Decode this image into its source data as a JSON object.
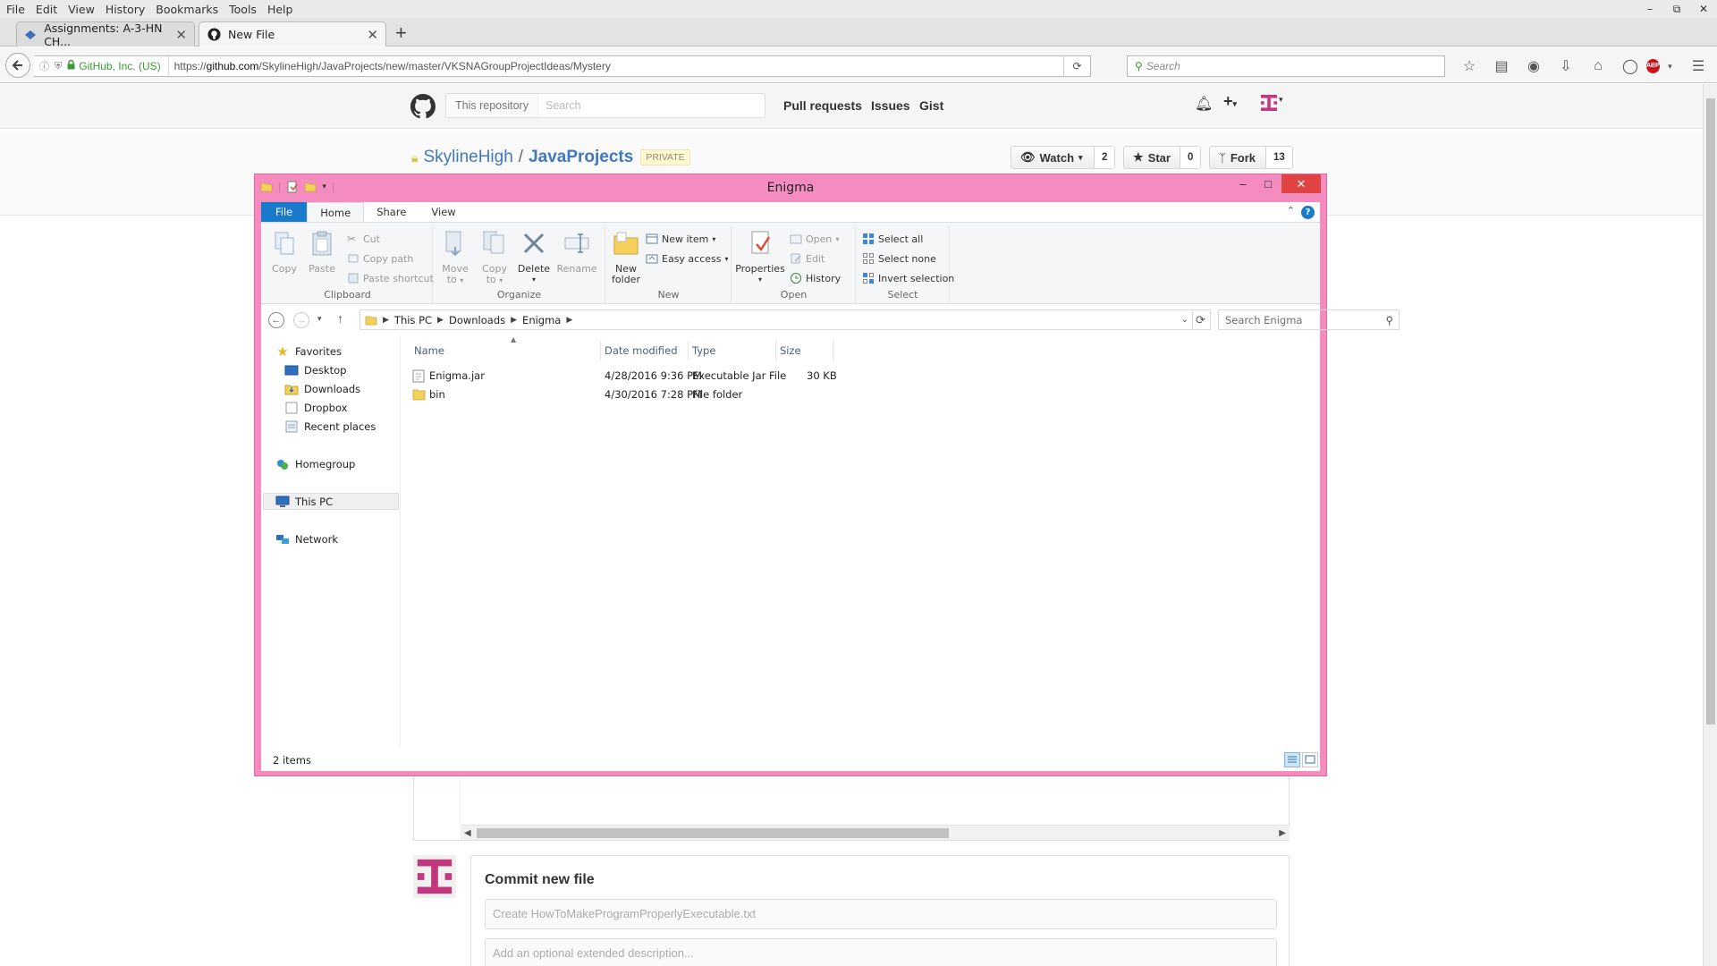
{
  "browser": {
    "menu": [
      "File",
      "Edit",
      "View",
      "History",
      "Bookmarks",
      "Tools",
      "Help"
    ],
    "tabs": [
      {
        "label": "Assignments: A-3-HN CH..."
      },
      {
        "label": "New File"
      }
    ],
    "identity": "GitHub, Inc. (US)",
    "url_prefix": "https://",
    "url_domain": "github.com",
    "url_path": "/SkylineHigh/JavaProjects/new/master/VKSNAGroupProjectIdeas/Mystery",
    "search_placeholder": "Search"
  },
  "github": {
    "search_scope": "This repository",
    "search_placeholder": "Search",
    "nav": [
      "Pull requests",
      "Issues",
      "Gist"
    ],
    "owner": "SkylineHigh",
    "repo": "JavaProjects",
    "private_label": "PRIVATE",
    "watch": {
      "label": "Watch",
      "count": "2"
    },
    "star": {
      "label": "Star",
      "count": "0"
    },
    "fork": {
      "label": "Fork",
      "count": "13"
    },
    "commit_title": "Commit new file",
    "commit_placeholder": "Create HowToMakeProgramProperlyExecutable.txt",
    "description_placeholder": "Add an optional extended description..."
  },
  "explorer": {
    "title": "Enigma",
    "ribbon_tabs": [
      "File",
      "Home",
      "Share",
      "View"
    ],
    "groups": {
      "clipboard": {
        "label": "Clipboard",
        "copy": "Copy",
        "paste": "Paste",
        "cut": "Cut",
        "copy_path": "Copy path",
        "paste_shortcut": "Paste shortcut"
      },
      "organize": {
        "label": "Organize",
        "move_to_1": "Move",
        "move_to_2": "to",
        "copy_to_1": "Copy",
        "copy_to_2": "to",
        "delete": "Delete",
        "rename": "Rename"
      },
      "new": {
        "label": "New",
        "new_folder_1": "New",
        "new_folder_2": "folder",
        "new_item": "New item",
        "easy_access": "Easy access"
      },
      "open": {
        "label": "Open",
        "properties": "Properties",
        "open": "Open",
        "edit": "Edit",
        "history": "History"
      },
      "select": {
        "label": "Select",
        "select_all": "Select all",
        "select_none": "Select none",
        "invert": "Invert selection"
      }
    },
    "breadcrumb": [
      "This PC",
      "Downloads",
      "Enigma"
    ],
    "search_placeholder": "Search Enigma",
    "nav": {
      "favorites": "Favorites",
      "desktop": "Desktop",
      "downloads": "Downloads",
      "dropbox": "Dropbox",
      "recent": "Recent places",
      "homegroup": "Homegroup",
      "this_pc": "This PC",
      "network": "Network"
    },
    "columns": {
      "name": "Name",
      "date": "Date modified",
      "type": "Type",
      "size": "Size"
    },
    "files": [
      {
        "name": "Enigma.jar",
        "date": "4/28/2016 9:36 PM",
        "type": "Executable Jar File",
        "size": "30 KB"
      },
      {
        "name": "bin",
        "date": "4/30/2016 7:28 PM",
        "type": "File folder",
        "size": ""
      }
    ],
    "status": "2 items"
  }
}
